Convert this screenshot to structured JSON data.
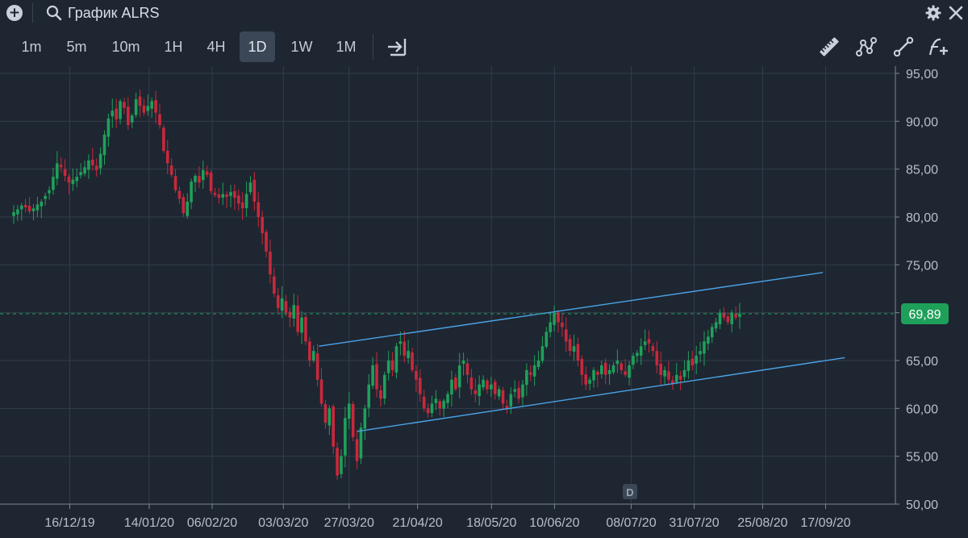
{
  "window": {
    "title": "График ALRS"
  },
  "toolbar": {
    "timeframes": [
      "1m",
      "5m",
      "10m",
      "1H",
      "4H",
      "1D",
      "1W",
      "1M"
    ],
    "active_timeframe": "1D",
    "icons": [
      "jump-to-end-icon",
      "ruler-icon",
      "multi-point-line-icon",
      "trend-line-icon",
      "add-indicator-icon"
    ]
  },
  "colors": {
    "background": "#1e2631",
    "grid": "#323d4b",
    "up_candle": "#1fa05a",
    "down_candle": "#c9283c",
    "channel_line": "#4aa3e8",
    "current_price": "#1fa05a"
  },
  "chart_data": {
    "type": "candlestick",
    "symbol": "ALRS",
    "interval": "1D",
    "ylim": [
      50,
      95
    ],
    "y_ticks": [
      "95,00",
      "90,00",
      "85,00",
      "80,00",
      "75,00",
      "70,00",
      "65,00",
      "60,00",
      "55,00",
      "50,00"
    ],
    "x_ticks": [
      "16/12/19",
      "14/01/20",
      "06/02/20",
      "03/03/20",
      "27/03/20",
      "21/04/20",
      "18/05/20",
      "10/06/20",
      "08/07/20",
      "31/07/20",
      "25/08/20",
      "17/09/20"
    ],
    "current_price": 69.89,
    "current_price_label": "69,89",
    "watermark": "D",
    "closes": [
      80.5,
      80.8,
      81.2,
      81.0,
      80.6,
      80.9,
      81.3,
      81.6,
      82.2,
      82.8,
      84.2,
      85.6,
      85.2,
      84.3,
      83.6,
      83.9,
      84.2,
      84.7,
      85.2,
      85.9,
      85.4,
      84.9,
      86.6,
      88.6,
      90.3,
      91.1,
      90.2,
      92.1,
      91.4,
      89.6,
      90.6,
      92.3,
      91.6,
      90.9,
      91.6,
      92.1,
      90.9,
      89.6,
      86.9,
      85.6,
      84.4,
      82.8,
      81.9,
      80.4,
      81.6,
      83.7,
      84.3,
      83.6,
      84.9,
      84.4,
      82.7,
      82.3,
      82.0,
      82.4,
      82.1,
      82.6,
      82.0,
      81.4,
      80.9,
      82.4,
      83.6,
      81.6,
      80.0,
      78.3,
      76.4,
      74.0,
      72.0,
      70.5,
      71.5,
      70.0,
      69.5,
      70.8,
      68.0,
      69.5,
      67.0,
      65.0,
      66.0,
      63.0,
      60.5,
      58.5,
      60.0,
      56.0,
      53.0,
      55.0,
      59.0,
      60.5,
      57.0,
      54.5,
      58.0,
      60.0,
      62.5,
      64.5,
      62.0,
      61.0,
      63.5,
      65.0,
      64.0,
      66.5,
      67.0,
      65.5,
      66.0,
      64.0,
      63.0,
      61.5,
      60.0,
      59.5,
      60.5,
      61.0,
      60.0,
      60.8,
      61.5,
      63.0,
      62.0,
      64.5,
      65.0,
      63.5,
      62.0,
      61.5,
      62.5,
      63.0,
      62.0,
      62.5,
      61.5,
      62.0,
      60.5,
      60.0,
      61.5,
      62.0,
      61.0,
      62.5,
      64.0,
      63.5,
      64.5,
      65.0,
      66.5,
      68.0,
      69.0,
      70.0,
      69.0,
      68.5,
      67.0,
      66.0,
      66.5,
      65.0,
      63.5,
      62.5,
      63.0,
      64.0,
      63.5,
      64.5,
      63.5,
      64.0,
      64.5,
      65.0,
      64.0,
      63.5,
      64.5,
      65.5,
      65.8,
      66.5,
      67.0,
      66.8,
      66.0,
      64.5,
      63.5,
      64.0,
      63.0,
      62.5,
      63.5,
      63.0,
      64.0,
      65.0,
      64.5,
      65.5,
      66.0,
      67.0,
      67.5,
      68.5,
      69.0,
      70.0,
      69.5,
      69.0,
      70.0,
      69.5,
      69.89
    ],
    "channel_upper": {
      "from": {
        "date": "16/03/20",
        "price": 66.5
      },
      "to": {
        "date": "16/09/20",
        "price": 74.2
      }
    },
    "channel_lower": {
      "from": {
        "date": "30/03/20",
        "price": 57.6
      },
      "to": {
        "date": "24/09/20",
        "price": 65.3
      }
    }
  }
}
